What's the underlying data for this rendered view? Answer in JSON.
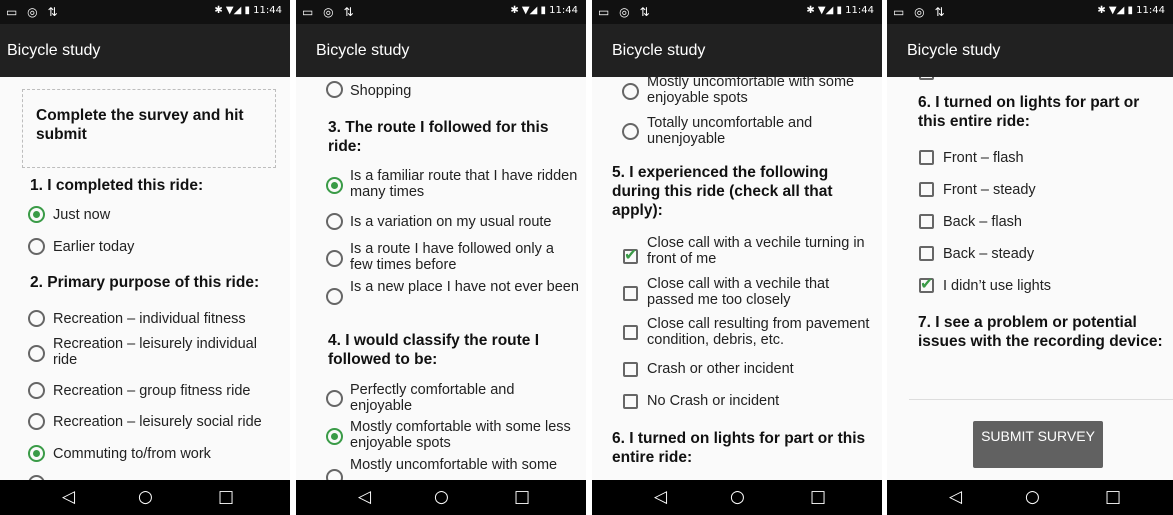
{
  "app_title": "Bicycle study",
  "status": {
    "left_icons": "▭ ◎ ⇅",
    "right": "✱ ▼◢ ▮ 11:44"
  },
  "nav": {
    "back": "◁",
    "home": "○",
    "recents": "□"
  },
  "s1": {
    "instruction": "Complete the survey and hit submit",
    "q1": "1. I completed this ride:",
    "q1_options": [
      "Just now",
      "Earlier today"
    ],
    "q2": "2. Primary purpose of this ride:",
    "q2_options": [
      "Recreation – individual fitness",
      "Recreation – leisurely individual ride",
      "Recreation – group fitness ride",
      "Recreation – leisurely social ride",
      "Commuting to/from work"
    ]
  },
  "s2": {
    "opt_shopping": "Shopping",
    "q3": "3. The route I followed for this ride:",
    "q3_options": [
      "Is a familiar route that I have ridden many times",
      "Is a variation on my usual route",
      "Is a route I have followed only a few times before",
      "Is a new place I have not ever been"
    ],
    "q4": "4. I would classify the route I followed to be:",
    "q4_options": [
      "Perfectly comfortable and enjoyable",
      "Mostly comfortable with some less enjoyable spots",
      "Mostly uncomfortable with some"
    ]
  },
  "s3": {
    "top_options": [
      "Mostly uncomfortable with some enjoyable spots",
      "Totally uncomfortable and unenjoyable"
    ],
    "q5": "5. I experienced the following during this ride (check all that apply):",
    "q5_options": [
      "Close call with a vechile turning in front of me",
      "Close call with a vechile that passed me too closely",
      "Close call resulting from pavement condition, debris, etc.",
      "Crash or other incident",
      "No Crash or incident"
    ],
    "q6": "6. I turned on lights for part or this entire ride:"
  },
  "s4": {
    "q6": "6. I turned on lights for part or this entire ride:",
    "q6_options": [
      "Front – flash",
      "Front – steady",
      "Back – flash",
      "Back – steady",
      "I didn’t use lights"
    ],
    "q7": "7. I see a problem or potential issues with the recording device:",
    "submit": "SUBMIT SURVEY"
  }
}
